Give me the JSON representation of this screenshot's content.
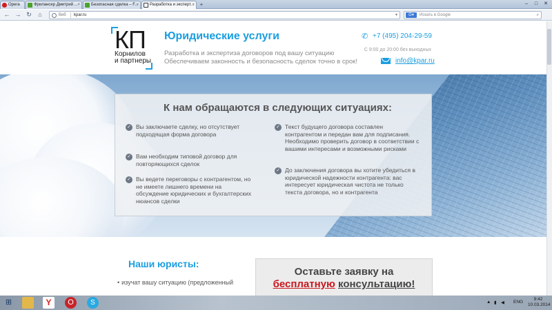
{
  "browser": {
    "tabs": [
      {
        "label": "Opera",
        "active": false
      },
      {
        "label": "Фрилансер Дмитрий ...",
        "active": false
      },
      {
        "label": "Безопасная сделка – F...",
        "active": false
      },
      {
        "label": "Разработка и эксперт...",
        "active": true
      }
    ],
    "url_prefix": "Веб",
    "url": "kpar.ru",
    "search_placeholder": "Искать в Google"
  },
  "header": {
    "logo_mark": "КП",
    "logo_line1": "Корнилов",
    "logo_line2": "и партнеры",
    "title": "Юридические услуги",
    "tagline1": "Разработка и экспертиза договоров под вашу ситуацию",
    "tagline2": "Обеспечиваем законность и безопасность сделок точно в срок!",
    "phone": "+7 (495) 204-29-59",
    "hours": "С 9:00 до 20:00 без выходных",
    "email": "info@kpar.ru"
  },
  "hero": {
    "title": "К нам обращаются в следующих ситуациях:",
    "left_items": [
      "Вы заключаете сделку, но отсутствует подходящая форма договора",
      "Вам необходим типовой договор для повторяющихся сделок",
      "Вы ведете переговоры с контрагентом, но не имеете лишнего времени на обсуждение юридических и бухгалтерских нюансов сделки"
    ],
    "right_items": [
      "Текст будущего договора составлен контрагентом и передан вам для подписания. Необходимо проверить договор в соответствии с вашими интересами и возможными рисками",
      "До заключения договора вы хотите убедиться в юридической надежности контрагента: вас интересует юридическая чистота не только текста договора, но и контрагента"
    ]
  },
  "lawyers": {
    "title": "Наши юристы:",
    "bullet": "изучат вашу ситуацию (предложенный"
  },
  "cta": {
    "line1": "Оставьте заявку на",
    "highlight": "бесплатную",
    "rest": "консультацию!"
  },
  "taskbar": {
    "lang": "ENG",
    "time": "9:42",
    "date": "10.03.2014"
  },
  "colors": {
    "accent": "#1a9ee0",
    "highlight_red": "#c9181e"
  }
}
